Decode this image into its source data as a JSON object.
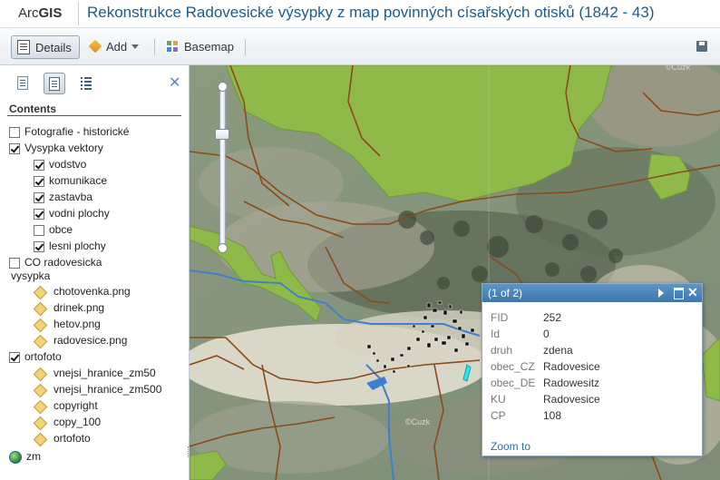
{
  "header": {
    "logo_prefix": "Arc",
    "logo_bold": "GIS",
    "title": "Rekonstrukce Radovesické výsypky z map povinných císařských otisků (1842 - 43)"
  },
  "toolbar": {
    "details_label": "Details",
    "add_label": "Add",
    "basemap_label": "Basemap"
  },
  "sidebar": {
    "contents_heading": "Contents",
    "layers": [
      {
        "label": "Fotografie - historické",
        "checked": false,
        "type": "checkbox",
        "indent": 0
      },
      {
        "label": "Vysypka vektory",
        "checked": true,
        "type": "checkbox",
        "indent": 0
      },
      {
        "label": "vodstvo",
        "checked": true,
        "type": "checkbox",
        "indent": 1
      },
      {
        "label": "komunikace",
        "checked": true,
        "type": "checkbox",
        "indent": 1
      },
      {
        "label": "zastavba",
        "checked": true,
        "type": "checkbox",
        "indent": 1
      },
      {
        "label": "vodni plochy",
        "checked": true,
        "type": "checkbox",
        "indent": 1
      },
      {
        "label": "obce",
        "checked": false,
        "type": "checkbox",
        "indent": 1
      },
      {
        "label": "lesni plochy",
        "checked": true,
        "type": "checkbox",
        "indent": 1
      },
      {
        "label": "CO radovesicka",
        "label2": "vysypka",
        "checked": false,
        "type": "checkbox",
        "indent": 0
      },
      {
        "label": "chotovenka.png",
        "type": "diamond",
        "indent": 1
      },
      {
        "label": "drinek.png",
        "type": "diamond",
        "indent": 1
      },
      {
        "label": "hetov.png",
        "type": "diamond",
        "indent": 1
      },
      {
        "label": "radovesice.png",
        "type": "diamond",
        "indent": 1
      },
      {
        "label": "ortofoto",
        "checked": true,
        "type": "checkbox",
        "indent": 0
      },
      {
        "label": "vnejsi_hranice_zm50",
        "type": "diamond",
        "indent": 1
      },
      {
        "label": "vnejsi_hranice_zm500",
        "type": "diamond",
        "indent": 1
      },
      {
        "label": "copyright",
        "type": "diamond",
        "indent": 1
      },
      {
        "label": "copy_100",
        "type": "diamond",
        "indent": 1
      },
      {
        "label": "ortofoto",
        "type": "diamond",
        "indent": 1
      },
      {
        "label": "zm",
        "type": "globe",
        "indent": 0
      }
    ]
  },
  "map": {
    "watermark": "©Cuzk",
    "colors": {
      "forest": "#8fba4a",
      "road": "#8a4a1a",
      "water": "#3f7fcf"
    }
  },
  "popup": {
    "counter": "(1 of 2)",
    "fields": [
      {
        "key": "FID",
        "value": "252"
      },
      {
        "key": "Id",
        "value": "0"
      },
      {
        "key": "druh",
        "value": "zdena"
      },
      {
        "key": "obec_CZ",
        "value": "Radovesice"
      },
      {
        "key": "obec_DE",
        "value": "Radowesitz"
      },
      {
        "key": "KU",
        "value": "Radovesice"
      },
      {
        "key": "CP",
        "value": "108"
      }
    ],
    "zoom_link": "Zoom to"
  }
}
